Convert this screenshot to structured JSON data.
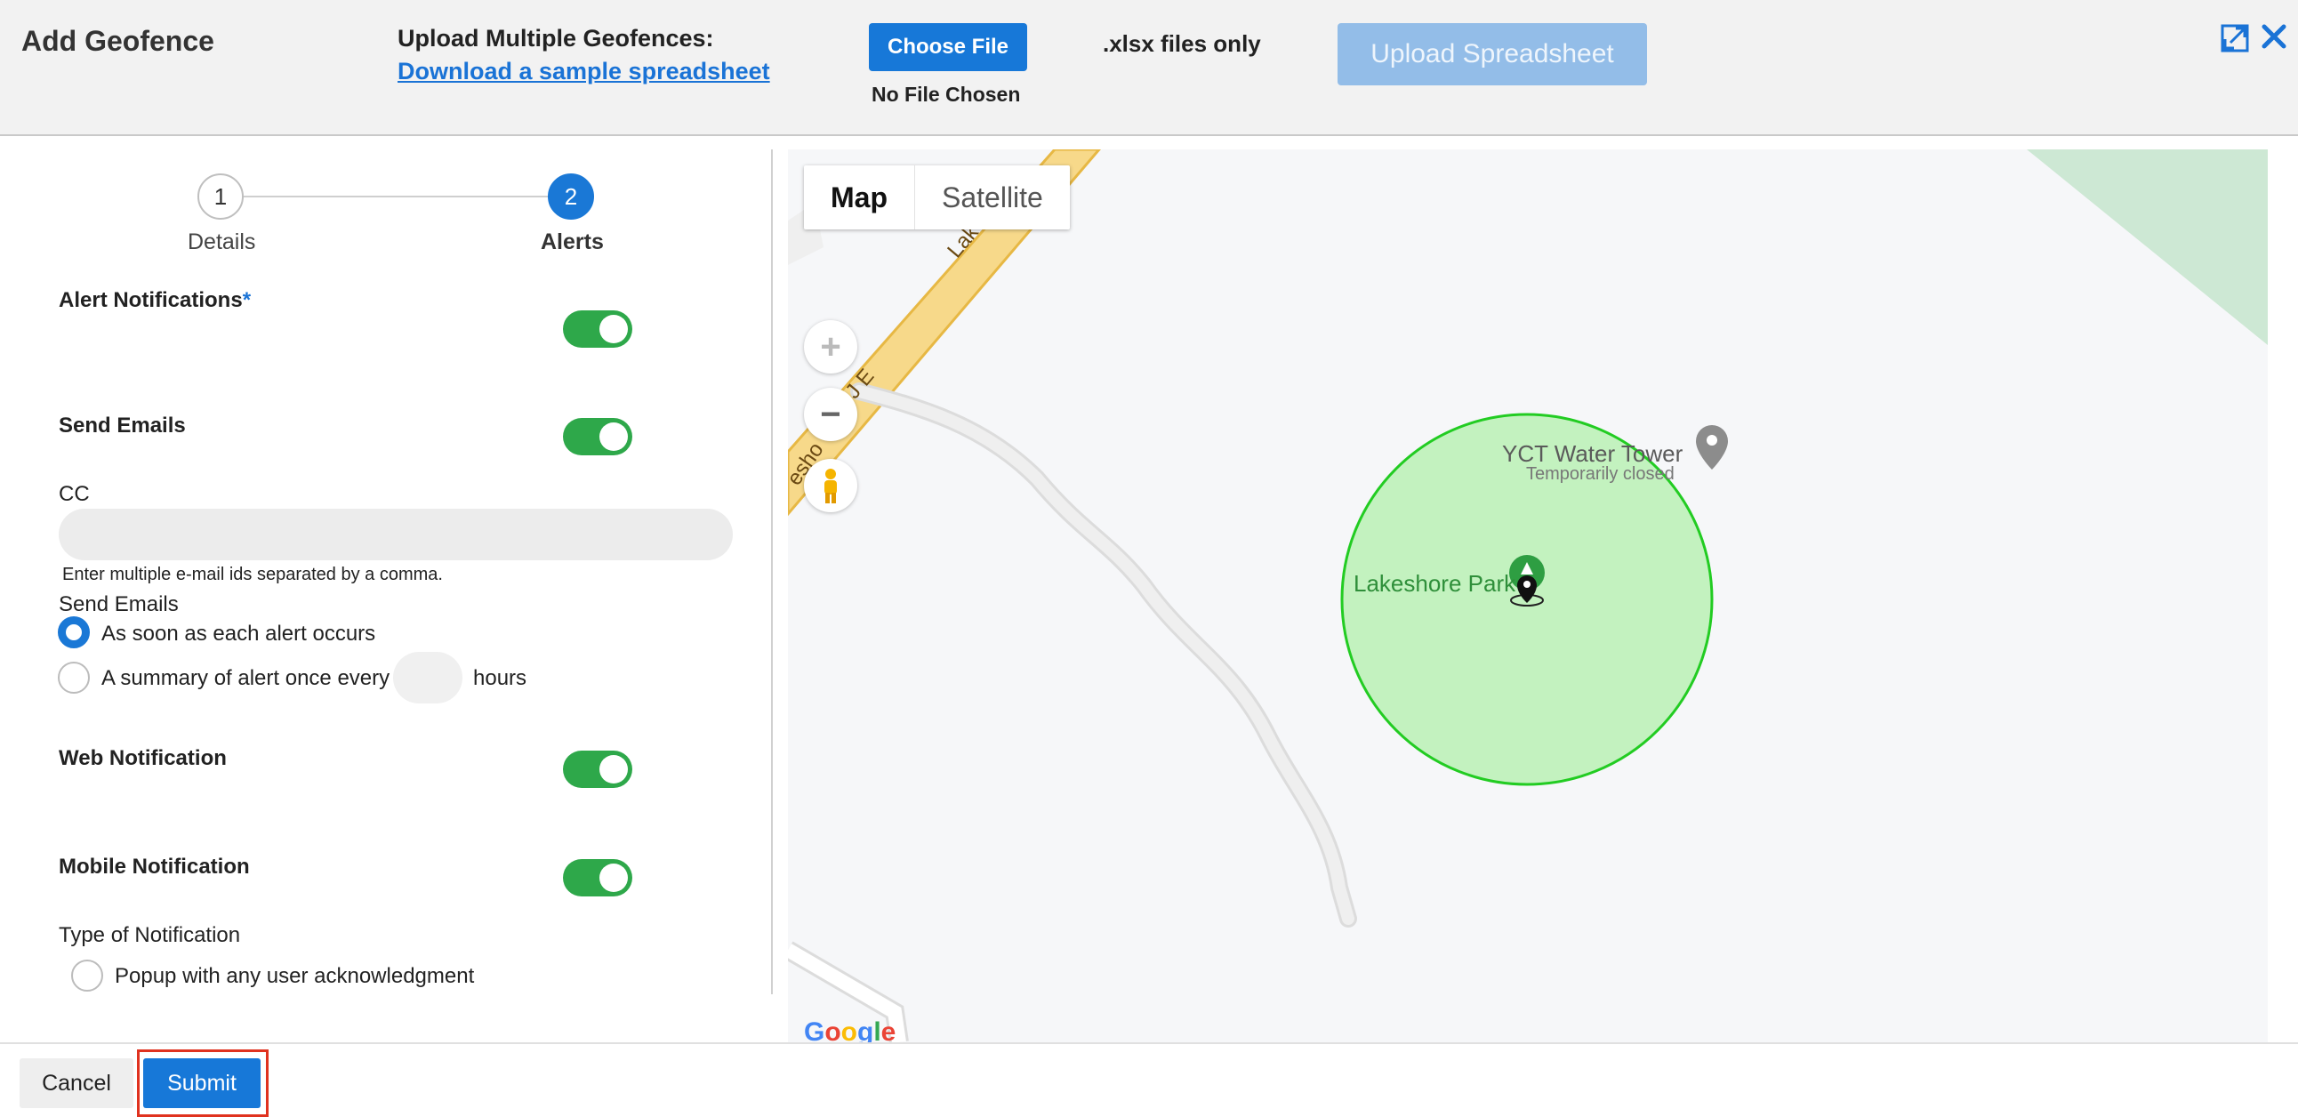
{
  "header": {
    "title": "Add Geofence",
    "upload_label": "Upload Multiple Geofences:",
    "sample_link": "Download a sample spreadsheet",
    "choose_file": "Choose File",
    "no_file": "No File Chosen",
    "file_note": ".xlsx files only",
    "upload_button": "Upload Spreadsheet"
  },
  "steps": [
    {
      "number": "1",
      "label": "Details"
    },
    {
      "number": "2",
      "label": "Alerts"
    }
  ],
  "alerts": {
    "alert_notifications": "Alert Notifications",
    "required_mark": "*",
    "send_emails": "Send Emails",
    "cc_label": "CC",
    "cc_value": "",
    "cc_hint": "Enter multiple e-mail ids separated by a comma.",
    "send_emails_sub": "Send Emails",
    "option_immediate": "As soon as each alert occurs",
    "option_summary": "A summary of alert once every",
    "hours_value": "",
    "hours_label": "hours",
    "web_notification": "Web Notification",
    "mobile_notification": "Mobile Notification",
    "type_label": "Type of Notification",
    "popup_option": "Popup with any user acknowledgment"
  },
  "toggles": {
    "alert_notifications": true,
    "send_emails": true,
    "web_notification": true,
    "mobile_notification": true
  },
  "map": {
    "type_map": "Map",
    "type_satellite": "Satellite",
    "zoom_in": "+",
    "zoom_out": "−",
    "poi_name": "YCT Water Tower",
    "poi_status": "Temporarily closed",
    "park_name": "Lakeshore Park",
    "road_text_a": "Lak",
    "road_text_b": "J E",
    "road_text_c": "esho",
    "logo": "Google",
    "fence_color": "#22cc22",
    "fence_fill": "#c3f2bf"
  },
  "footer": {
    "cancel": "Cancel",
    "submit": "Submit"
  }
}
